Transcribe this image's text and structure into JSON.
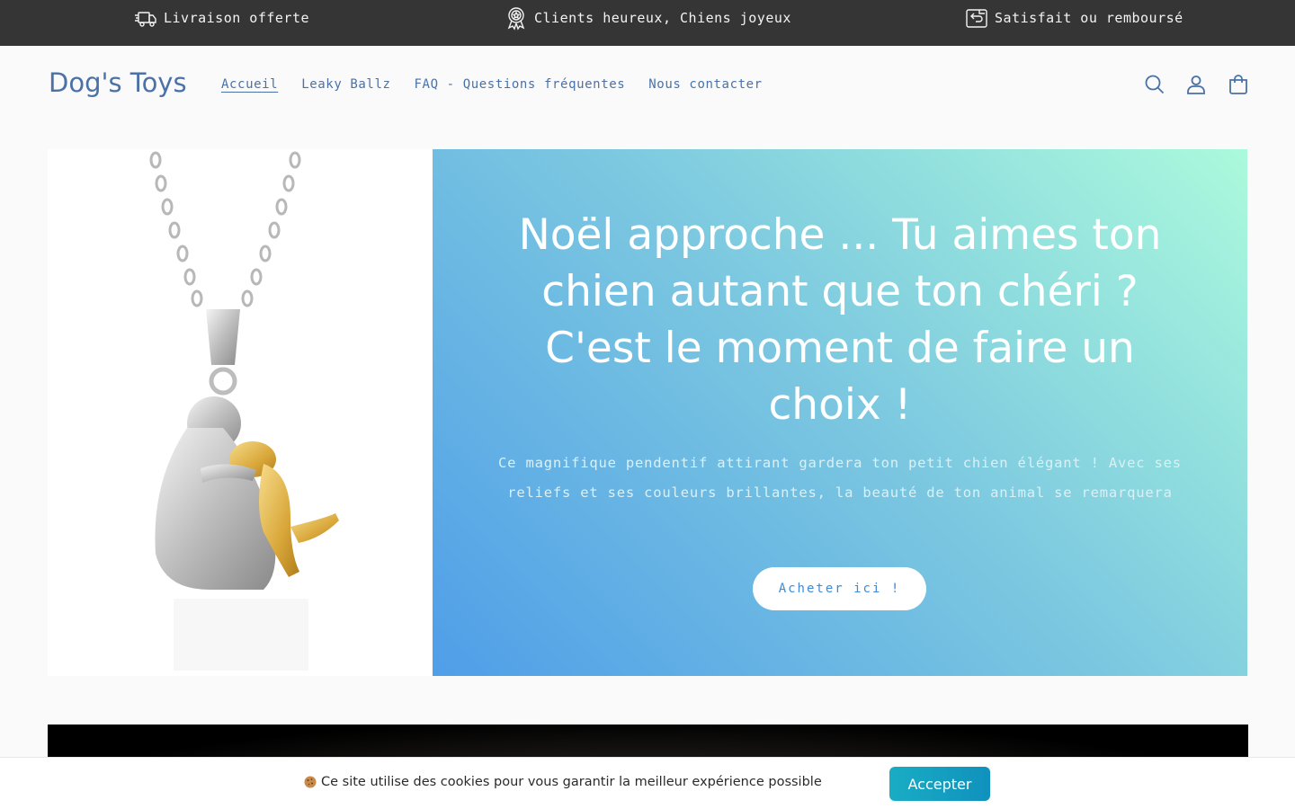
{
  "announcement": {
    "items": [
      {
        "icon": "delivery-truck-icon",
        "text": "Livraison offerte"
      },
      {
        "icon": "award-badge-icon",
        "text": "Clients heureux, Chiens joyeux"
      },
      {
        "icon": "return-box-icon",
        "text": "Satisfait ou remboursé"
      }
    ]
  },
  "header": {
    "logo": "Dog's Toys",
    "nav": [
      "Accueil",
      "Leaky Ballz",
      "FAQ - Questions fréquentes",
      "Nous contacter"
    ],
    "active_nav": "Accueil",
    "icons": [
      "search-icon",
      "account-icon",
      "cart-icon"
    ]
  },
  "hero": {
    "title": "Noël approche ... Tu aimes ton chien autant que ton chéri ? C'est le moment de faire un choix !",
    "text": "Ce magnifique pendentif attirant gardera ton petit chien élégant ! Avec ses reliefs et ses couleurs brillantes, la beauté de ton animal se remarquera",
    "button": "Acheter ici !",
    "colors": {
      "gradient_start": "#abfadc",
      "gradient_mid": "#7cc8e0",
      "gradient_end": "#4f9ee8"
    }
  },
  "cookie": {
    "text": "Ce site utilise des cookies pour vous garantir la meilleur expérience possible",
    "button": "Accepter",
    "icon": "cookie-icon"
  },
  "colors": {
    "announcement_bg": "#353535",
    "brand": "#4a72a8",
    "cookie_button": "#19adc4"
  }
}
